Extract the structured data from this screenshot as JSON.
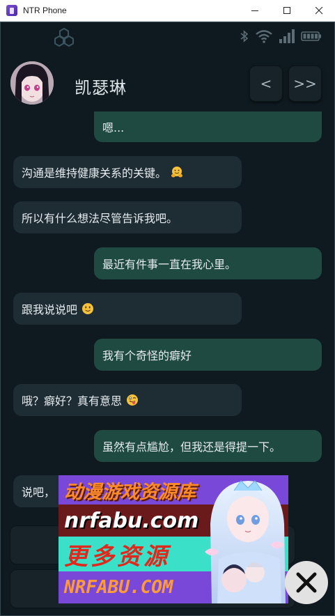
{
  "window": {
    "title": "NTR Phone"
  },
  "header": {
    "contact_name": "凯瑟琳",
    "prev_label": "<",
    "next_label": ">>"
  },
  "messages": [
    {
      "side": "out",
      "text": "嗯..."
    },
    {
      "side": "in",
      "text": "沟通是维持健康关系的关键。",
      "emoji": "hugging-face"
    },
    {
      "side": "in",
      "text": "所以有什么想法尽管告诉我吧。"
    },
    {
      "side": "out",
      "text": "最近有件事一直在我心里。"
    },
    {
      "side": "in",
      "text": "跟我说说吧",
      "emoji": "slightly-smiling-face"
    },
    {
      "side": "out",
      "text": "我有个奇怪的癖好"
    },
    {
      "side": "in",
      "text": "哦？癖好？真有意思",
      "emoji": "winking-tongue-face"
    },
    {
      "side": "out",
      "text": "虽然有点尴尬，但我还是得提一下。"
    },
    {
      "side": "in",
      "text": "说吧，"
    }
  ],
  "ad": {
    "line1": "动漫游戏资源库",
    "line2": "nrfabu.com",
    "line3": "更多资源",
    "line4": "NRFABU.COM"
  },
  "colors": {
    "phone_bg": "#0f1a20",
    "incoming_bubble": "#1e2c33",
    "outgoing_bubble": "#1f4a42",
    "text": "#e6ecef"
  }
}
